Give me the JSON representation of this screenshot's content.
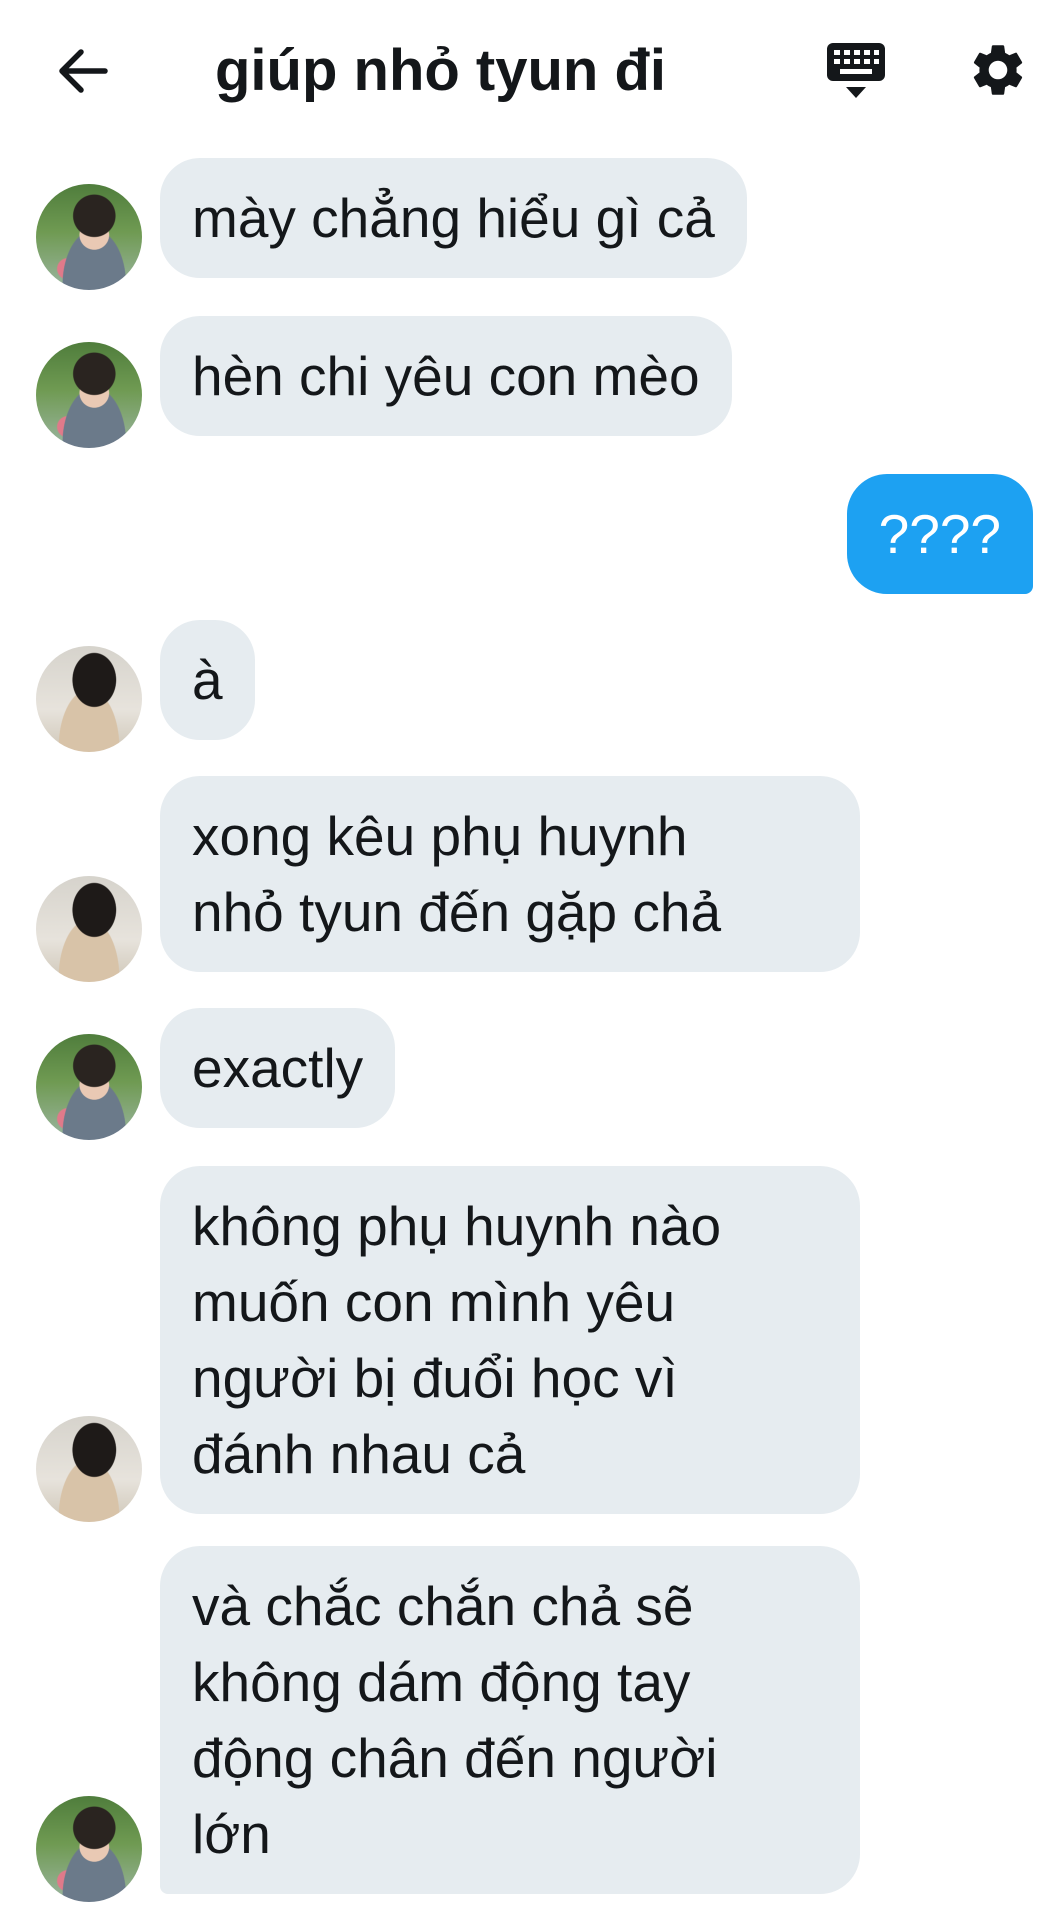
{
  "header": {
    "title": "giúp nhỏ tyun đi",
    "back_icon": "arrow-left-icon",
    "keyboard_icon": "keyboard-icon",
    "settings_icon": "gear-icon"
  },
  "colors": {
    "incoming_bubble": "#e6ecf0",
    "outgoing_bubble": "#1da1f2",
    "text": "#14171a"
  },
  "messages": [
    {
      "direction": "incoming",
      "avatar": "boy",
      "text": "mày chẳng hiểu gì cả"
    },
    {
      "direction": "incoming",
      "avatar": "boy",
      "text": "hèn chi yêu con mèo"
    },
    {
      "direction": "outgoing",
      "text": "????"
    },
    {
      "direction": "incoming",
      "avatar": "girl",
      "text": "à"
    },
    {
      "direction": "incoming",
      "avatar": "girl",
      "text": "xong kêu phụ huynh\nnhỏ tyun đến gặp chả"
    },
    {
      "direction": "incoming",
      "avatar": "boy",
      "text": "exactly"
    },
    {
      "direction": "incoming",
      "avatar": "girl",
      "text": "không phụ huynh nào\nmuốn con mình yêu\nngười bị đuổi học vì\nđánh nhau cả"
    },
    {
      "direction": "incoming",
      "avatar": "boy",
      "text": "và chắc chắn chả sẽ\nkhông dám động tay\nđộng chân đến người\nlớn"
    }
  ]
}
